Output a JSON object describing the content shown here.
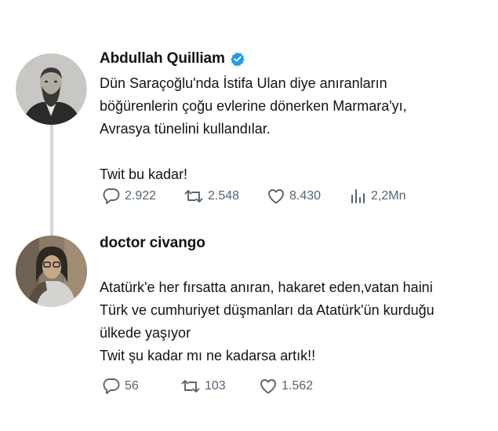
{
  "tweets": [
    {
      "author": "Abdullah Quilliam",
      "verified": true,
      "text": "Dün Saraçoğlu'nda İstifa Ulan diye anıranların\nböğürenlerin çoğu evlerine dönerken Marmara'yı,\nAvrasya tünelini kullandılar.\n\nTwit bu kadar!",
      "replies": "2.922",
      "retweets": "2.548",
      "likes": "8.430",
      "views": "2,2Mn"
    },
    {
      "author": "doctor civango",
      "verified": false,
      "text": "Atatürk'e her fırsatta anıran, hakaret eden,vatan haini\nTürk ve cumhuriyet düşmanları da Atatürk'ün kurduğu\nülkede yaşıyor\nTwit şu kadar mı ne kadarsa artık!!",
      "replies": "56",
      "retweets": "103",
      "likes": "1.562"
    }
  ],
  "colors": {
    "text": "#0f1419",
    "muted": "#536471",
    "verified": "#1d9bf0",
    "thread_line": "#cfd9de"
  },
  "icons": [
    "reply-icon",
    "retweet-icon",
    "like-icon",
    "views-icon",
    "verified-badge-icon"
  ]
}
